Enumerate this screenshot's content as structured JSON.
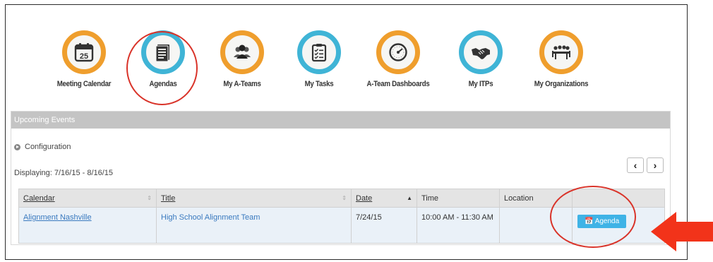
{
  "nav": {
    "items": [
      {
        "label": "Meeting Calendar",
        "icon": "calendar-icon",
        "color": "#ef9e2d",
        "calendar_day": "25"
      },
      {
        "label": "Agendas",
        "icon": "notepad-icon",
        "color": "#3fb4d6"
      },
      {
        "label": "My A-Teams",
        "icon": "people-icon",
        "color": "#ef9e2d"
      },
      {
        "label": "My Tasks",
        "icon": "clipboard-icon",
        "color": "#3fb4d6"
      },
      {
        "label": "A-Team Dashboards",
        "icon": "gauge-icon",
        "color": "#ef9e2d"
      },
      {
        "label": "My ITPs",
        "icon": "handshake-icon",
        "color": "#3fb4d6"
      },
      {
        "label": "My Organizations",
        "icon": "meeting-table-icon",
        "color": "#ef9e2d"
      }
    ]
  },
  "panel": {
    "title": "Upcoming Events",
    "configuration_label": "Configuration",
    "displaying": "Displaying: 7/16/15 - 8/16/15",
    "pager": {
      "prev": "‹",
      "next": "›"
    }
  },
  "table": {
    "columns": [
      "Calendar",
      "Title",
      "Date",
      "Time",
      "Location"
    ],
    "rows": [
      {
        "calendar": "Alignment Nashville",
        "title": "High School Alignment Team",
        "date": "7/24/15",
        "time": "10:00 AM - 11:30 AM",
        "location": "",
        "action": "Agenda"
      }
    ]
  },
  "colors": {
    "orange": "#ef9e2d",
    "blue": "#3fb4d6",
    "highlight": "#d93329",
    "arrow": "#f2331a",
    "button": "#3fb3e6"
  }
}
